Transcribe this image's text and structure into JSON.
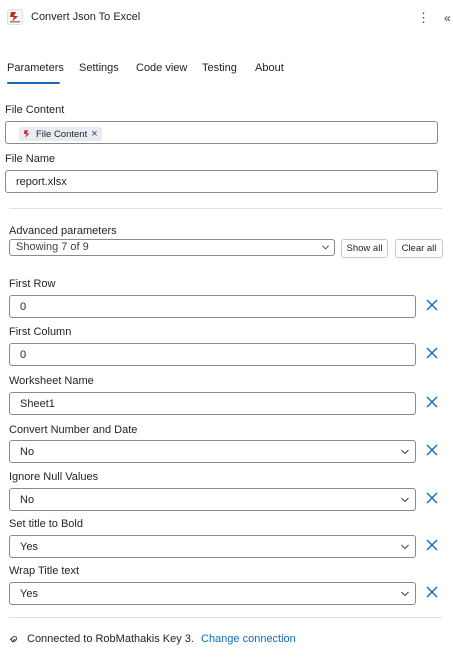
{
  "header": {
    "title": "Convert Json To Excel",
    "more_icon": "more-vertical-icon",
    "collapse_icon": "collapse-panel-icon"
  },
  "tabs": [
    {
      "label": "Parameters",
      "active": true
    },
    {
      "label": "Settings",
      "active": false
    },
    {
      "label": "Code view",
      "active": false
    },
    {
      "label": "Testing",
      "active": false
    },
    {
      "label": "About",
      "active": false
    }
  ],
  "fields": {
    "file_content": {
      "label": "File Content",
      "token": "File Content"
    },
    "file_name": {
      "label": "File Name",
      "value": "report.xlsx"
    }
  },
  "advanced": {
    "label": "Advanced parameters",
    "selected": "Showing 7 of 9",
    "show_all": "Show all",
    "clear_all": "Clear all"
  },
  "params": {
    "first_row": {
      "label": "First Row",
      "value": "0"
    },
    "first_column": {
      "label": "First Column",
      "value": "0"
    },
    "worksheet_name": {
      "label": "Worksheet Name",
      "value": "Sheet1"
    },
    "convert_number_date": {
      "label": "Convert Number and Date",
      "value": "No"
    },
    "ignore_null": {
      "label": "Ignore Null Values",
      "value": "No"
    },
    "title_bold": {
      "label": "Set title to Bold",
      "value": "Yes"
    },
    "wrap_title": {
      "label": "Wrap Title text",
      "value": "Yes"
    }
  },
  "footer": {
    "connection": "Connected to RobMathakis Key 3.",
    "change": "Change connection"
  },
  "colors": {
    "accent": "#0f6cbd",
    "brand_red": "#c42b1c"
  }
}
